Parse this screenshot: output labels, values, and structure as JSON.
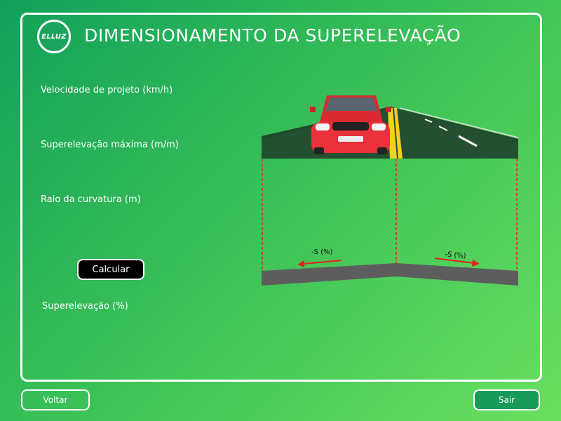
{
  "header": {
    "logo_text": "ELLUZ",
    "title": "DIMENSIONAMENTO DA SUPERELEVAÇÃO"
  },
  "form": {
    "speed_label": "Velocidade de projeto (km/h)",
    "max_superelevation_label": "Superelevação máxima (m/m)",
    "radius_label": "Raio da curvatura (m)",
    "calculate_label": "Calcular",
    "result_label": "Superelevação (%)"
  },
  "illustration": {
    "left_slope_label": "-S (%)",
    "right_slope_label": "-S (%)"
  },
  "footer": {
    "back_label": "Voltar",
    "exit_label": "Sair"
  },
  "colors": {
    "background_start": "#12a05a",
    "background_end": "#6ae060",
    "road": "#1f4a2b",
    "car": "#e8313a",
    "slope_arrow": "#e82020",
    "road_section": "#5d5d5d",
    "button_dark": "#000000"
  }
}
